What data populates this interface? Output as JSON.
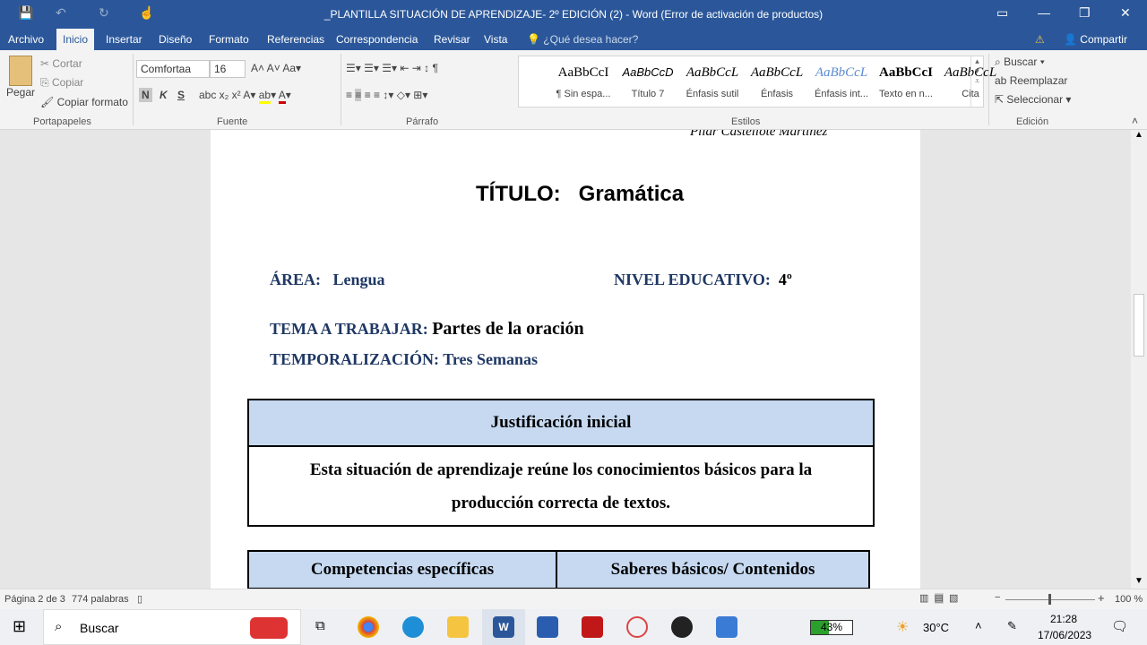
{
  "window": {
    "title": "_PLANTILLA SITUACIÓN DE APRENDIZAJE- 2º EDICIÓN (2) - Word (Error de activación de productos)"
  },
  "tabs": [
    "Archivo",
    "Inicio",
    "Insertar",
    "Diseño",
    "Formato",
    "Referencias",
    "Correspondencia",
    "Revisar",
    "Vista"
  ],
  "tell_me": "¿Qué desea hacer?",
  "share": "Compartir",
  "clipboard": {
    "paste": "Pegar",
    "cut": "Cortar",
    "copy": "Copiar",
    "format_painter": "Copiar formato",
    "group": "Portapapeles"
  },
  "font": {
    "name": "Comfortaa",
    "size": "16",
    "group": "Fuente",
    "bold": "N",
    "italic": "K",
    "underline": "S"
  },
  "paragraph": {
    "group": "Párrafo"
  },
  "styles": {
    "group": "Estilos",
    "items": [
      {
        "preview": "AaBbCcI",
        "name": "¶ Sin espa..."
      },
      {
        "preview": "AaBbCcD",
        "name": "Título 7"
      },
      {
        "preview": "AaBbCcL",
        "name": "Énfasis sutil"
      },
      {
        "preview": "AaBbCcL",
        "name": "Énfasis"
      },
      {
        "preview": "AaBbCcL",
        "name": "Énfasis int..."
      },
      {
        "preview": "AaBbCcI",
        "name": "Texto en n..."
      },
      {
        "preview": "AaBbCcL",
        "name": "Cita"
      }
    ]
  },
  "editing": {
    "find": "Buscar",
    "replace": "Reemplazar",
    "select": "Seleccionar",
    "group": "Edición"
  },
  "doc": {
    "author": "Pilar Castellote Martínez",
    "title_label": "TÍTULO:",
    "title_value": "Gramática",
    "area_label": "ÁREA:",
    "area_value": "Lengua",
    "level_label": "NIVEL EDUCATIVO:",
    "level_value": "4º",
    "topic_label": "TEMA A TRABAJAR:",
    "topic_value": "Partes de la oración",
    "timing_label": "TEMPORALIZACIÓN:",
    "timing_value": "Tres Semanas",
    "table1_header": "Justificación inicial",
    "table1_body": "Esta situación de aprendizaje reúne los conocimientos básicos para la producción correcta de textos.",
    "table2_headers": [
      "Competencias específicas",
      "Saberes básicos/ Contenidos"
    ]
  },
  "status": {
    "page": "Página 2 de 3",
    "words": "774 palabras",
    "zoom": "100 %"
  },
  "taskbar": {
    "search": "Buscar",
    "battery": "43%",
    "weather": "30°C",
    "time": "21:28",
    "date": "17/06/2023"
  }
}
